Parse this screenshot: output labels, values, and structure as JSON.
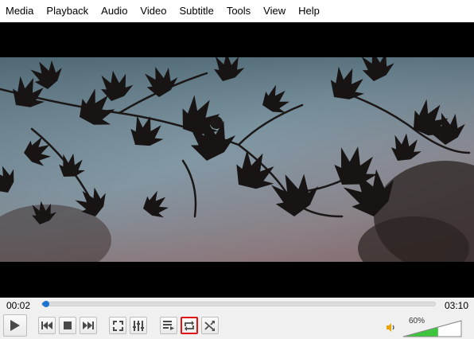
{
  "menu": {
    "items": [
      "Media",
      "Playback",
      "Audio",
      "Video",
      "Subtitle",
      "Tools",
      "View",
      "Help"
    ]
  },
  "player": {
    "time_elapsed": "00:02",
    "time_total": "03:10",
    "progress": 0.011,
    "volume_label": "60%",
    "volume": 0.6,
    "loop_active": true
  },
  "icons": {
    "play": "play-icon",
    "previous": "skip-previous-icon",
    "stop": "stop-icon",
    "next": "skip-next-icon",
    "fullscreen": "fullscreen-icon",
    "extended": "equalizer-sliders-icon",
    "playlist": "playlist-icon",
    "loop": "loop-icon",
    "random": "shuffle-icon",
    "volume": "speaker-icon"
  },
  "colors": {
    "accent": "#1f7fd8",
    "volume_fill": "#3cc43c",
    "loop_highlight": "#e01414"
  }
}
